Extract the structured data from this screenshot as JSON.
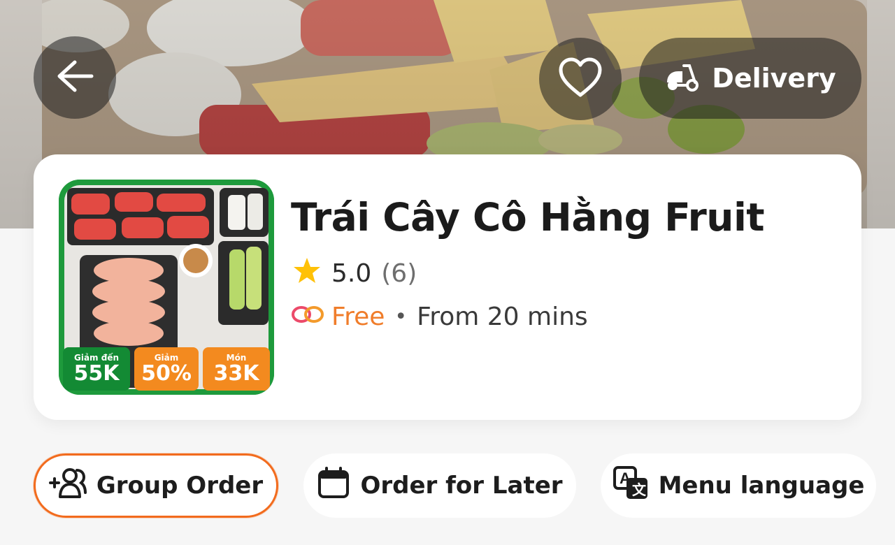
{
  "hero": {
    "image": "fruit-box-photo"
  },
  "top_bar": {
    "back_icon": "arrow-left-icon",
    "favorite_icon": "heart-icon",
    "delivery_icon": "scooter-icon",
    "delivery_label": "Delivery"
  },
  "store": {
    "name": "Trái Cây Cô Hằng Fruit",
    "rating": "5.0",
    "rating_count": "(6)",
    "delivery_fee": "Free",
    "separator": "•",
    "eta": "From 20 mins",
    "thumbnail_badges": [
      {
        "top": "Giảm đến",
        "value": "55K"
      },
      {
        "top": "Giảm",
        "value": "50%"
      },
      {
        "top": "Món",
        "value": "33K"
      }
    ]
  },
  "actions": {
    "group_order": "Group Order",
    "order_later": "Order for Later",
    "menu_language": "Menu language"
  },
  "colors": {
    "accent": "#f26b1d",
    "fee": "#f07d2b",
    "star": "#ffc107"
  }
}
